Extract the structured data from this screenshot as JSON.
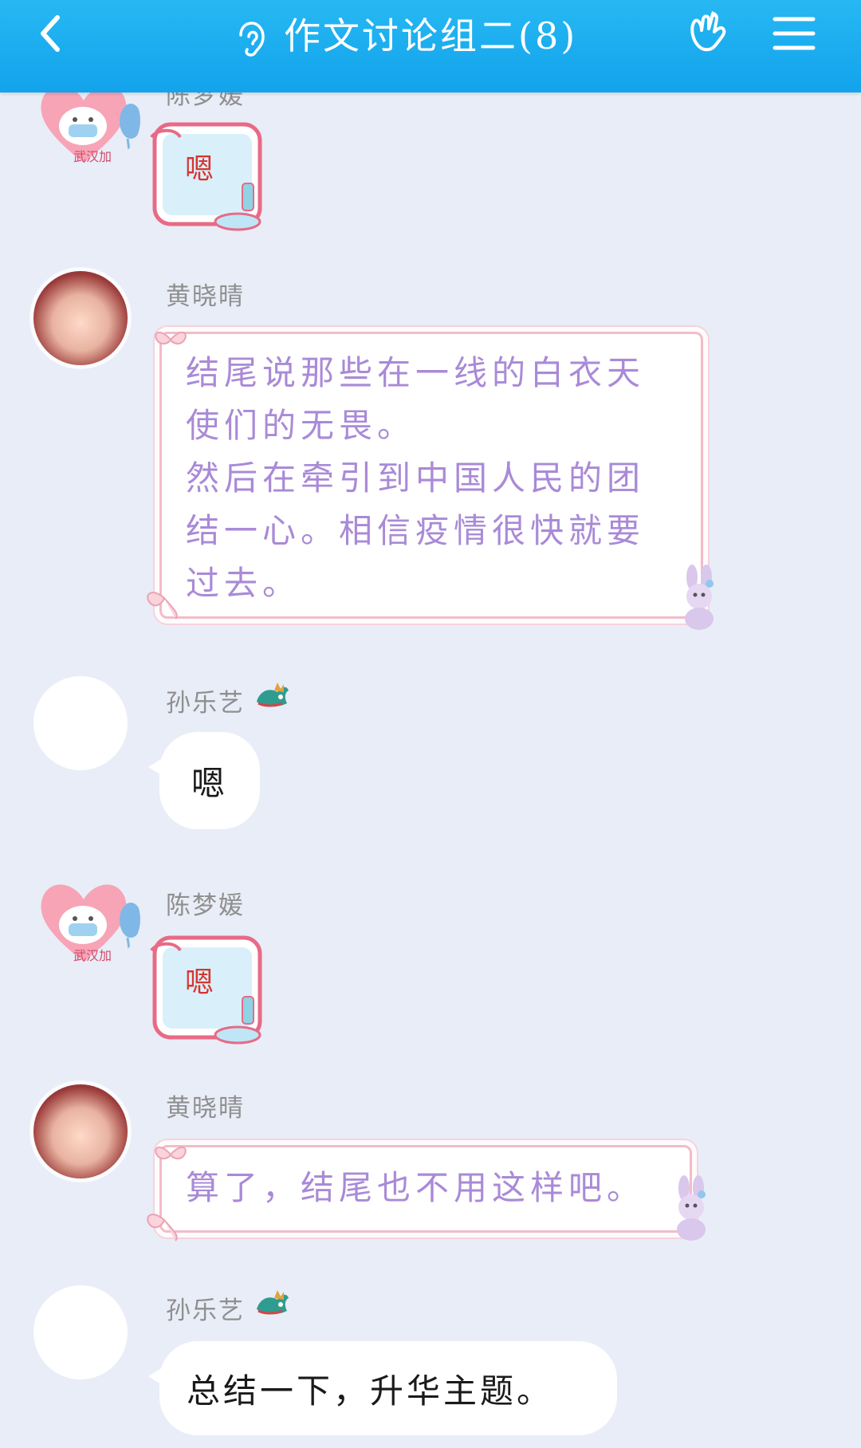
{
  "header": {
    "title": "作文讨论组二(8)",
    "colors": {
      "bar": "#19a8ef",
      "text": "#ffffff"
    },
    "icons": [
      "back-icon",
      "ear-icon",
      "hand-icon",
      "menu-icon"
    ]
  },
  "messages": [
    {
      "sender": "陈梦媛",
      "type": "sticker",
      "sticker_text": "嗯",
      "avatar": "wuhan-jiayou-cat",
      "avatar_text": "武汉加"
    },
    {
      "sender": "黄晓晴",
      "type": "decorated",
      "lines": [
        "结尾说那些在一线的白衣天",
        "使们的无畏。",
        "然后在牵引到中国人民的团",
        "结一心。相信疫情很快就要",
        "过去。"
      ]
    },
    {
      "sender": "孙乐艺",
      "type": "plain",
      "text": "嗯"
    },
    {
      "sender": "陈梦媛",
      "type": "sticker",
      "sticker_text": "嗯",
      "avatar": "wuhan-jiayou-cat",
      "avatar_text": "武汉加"
    },
    {
      "sender": "黄晓晴",
      "type": "decorated",
      "lines": [
        "算了，结尾也不用这样吧。"
      ]
    },
    {
      "sender": "孙乐艺",
      "type": "plain",
      "text": "总结一下，升华主题。"
    }
  ]
}
